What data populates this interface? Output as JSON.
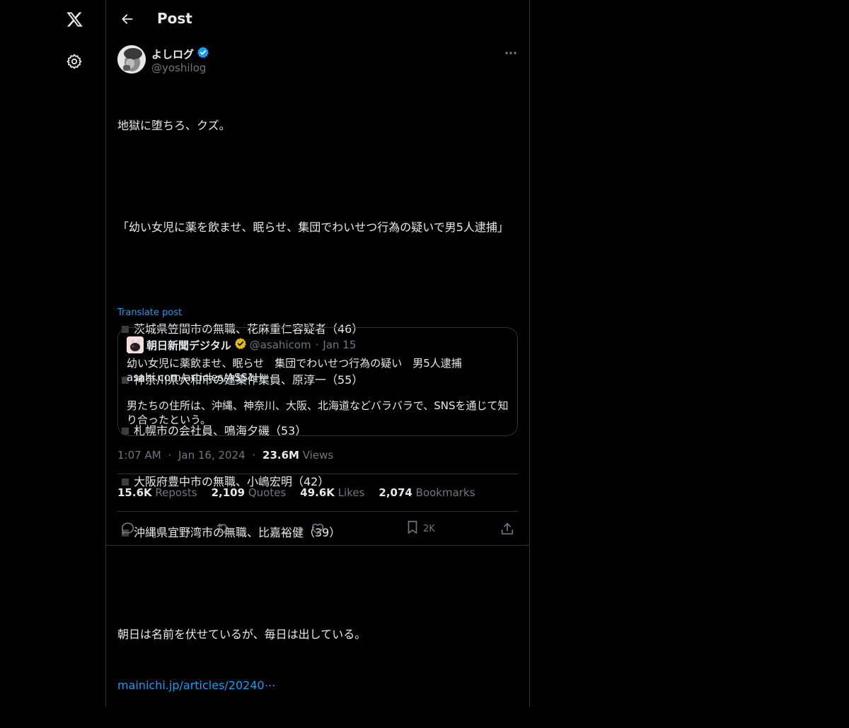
{
  "sidebar": {
    "logo": "x-logo-icon",
    "settings": "gear-icon"
  },
  "header": {
    "title": "Post"
  },
  "post": {
    "author_name": "よしログ",
    "author_handle": "@yoshilog",
    "body": {
      "line1": "地獄に堕ちろ、クズ。",
      "headline": "「幼い女児に薬を飲ませ、眠らせ、集団でわいせつ行為の疑いで男5人逮捕」",
      "bullets": [
        "茨城県笠間市の無職、花麻重仁容疑者（46）",
        "神奈川県大和市の建築作業員、原淳一（55）",
        "札幌市の会社員、鳴海夕磯（53）",
        "大阪府豊中市の無職、小嶋宏明（42）",
        "沖縄県宜野湾市の無職、比嘉裕健（39）"
      ],
      "closing": "朝日は名前を伏せているが、毎日は出している。",
      "link": "mainichi.jp/articles/20240⋯"
    },
    "translate": "Translate post",
    "quote": {
      "name": "朝日新聞デジタル",
      "handle": "@asahicom",
      "separator": "·",
      "date": "Jan 15",
      "text1": "幼い女児に薬飲ませ、眠らせ　集団でわいせつ行為の疑い　男5人逮捕",
      "link": "asahi.com/articles/ASS1H⋯",
      "text2": "男たちの住所は、沖縄、神奈川、大阪、北海道などバラバラで、SNSを通じて知り合ったという。"
    },
    "meta": {
      "time": "1:07 AM",
      "separator": "·",
      "date": "Jan 16, 2024",
      "views_count": "23.6M",
      "views_label": "Views"
    },
    "stats": {
      "reposts_count": "15.6K",
      "reposts_label": "Reposts",
      "quotes_count": "2,109",
      "quotes_label": "Quotes",
      "likes_count": "49.6K",
      "likes_label": "Likes",
      "bookmarks_count": "2,074",
      "bookmarks_label": "Bookmarks"
    },
    "actions": {
      "bookmark_count": "2K"
    }
  },
  "colors": {
    "background": "#000000",
    "accent": "#1d9bf0",
    "muted": "#71767b",
    "border": "#2f3336",
    "gold_badge": "#e2b719"
  }
}
